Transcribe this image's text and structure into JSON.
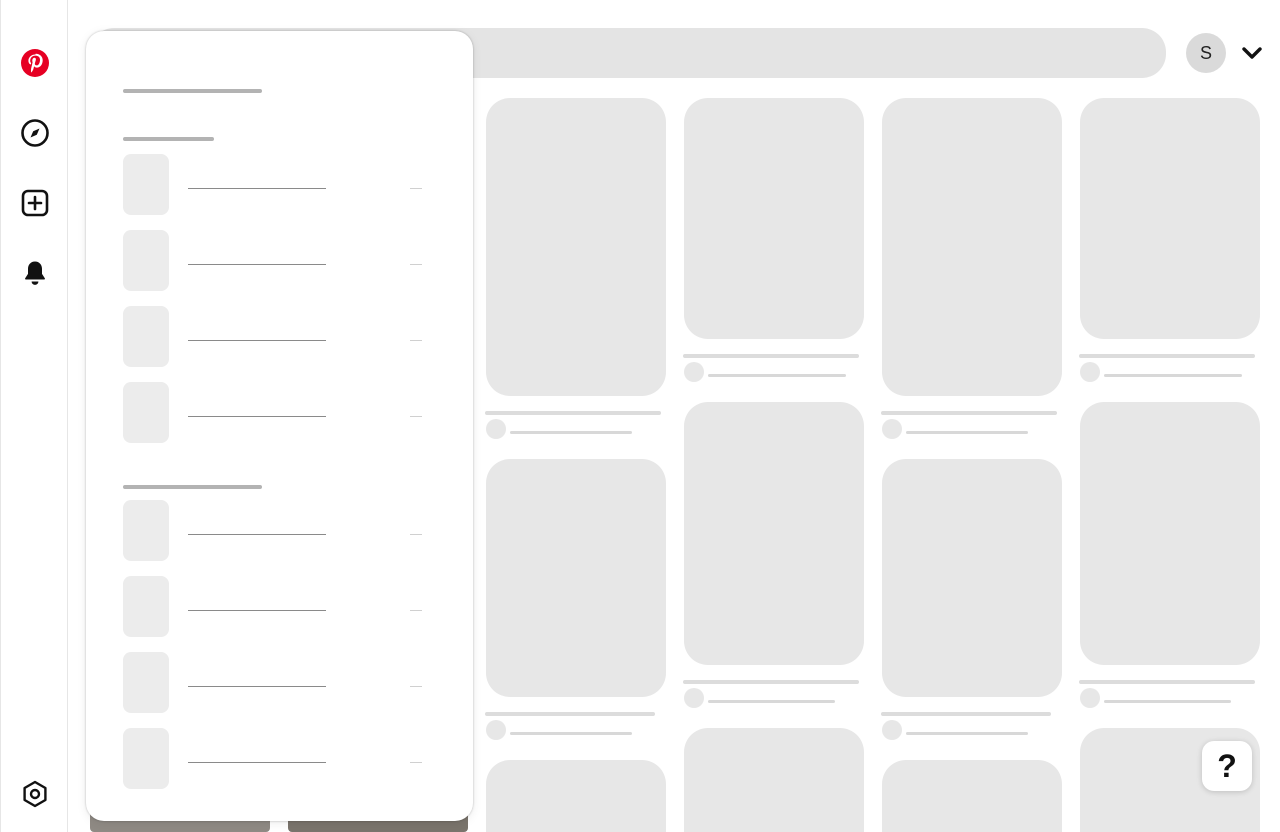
{
  "header": {
    "avatar_initial": "S"
  },
  "help": {
    "label": "?"
  },
  "colors": {
    "brand": "#e60023",
    "skeleton": "#e7e7e7",
    "search_bg": "#e4e4e4"
  },
  "nav": {
    "items": [
      {
        "icon": "pinterest-logo-icon"
      },
      {
        "icon": "explore-compass-icon"
      },
      {
        "icon": "create-plus-icon"
      },
      {
        "icon": "notifications-bell-icon"
      },
      {
        "icon": "settings-icon"
      }
    ]
  },
  "account_dropdown": {
    "state": "loading",
    "sections": [
      {
        "item_count": 4
      },
      {
        "item_count": 4
      }
    ]
  },
  "feed": {
    "state": "loading",
    "columns": 4
  }
}
